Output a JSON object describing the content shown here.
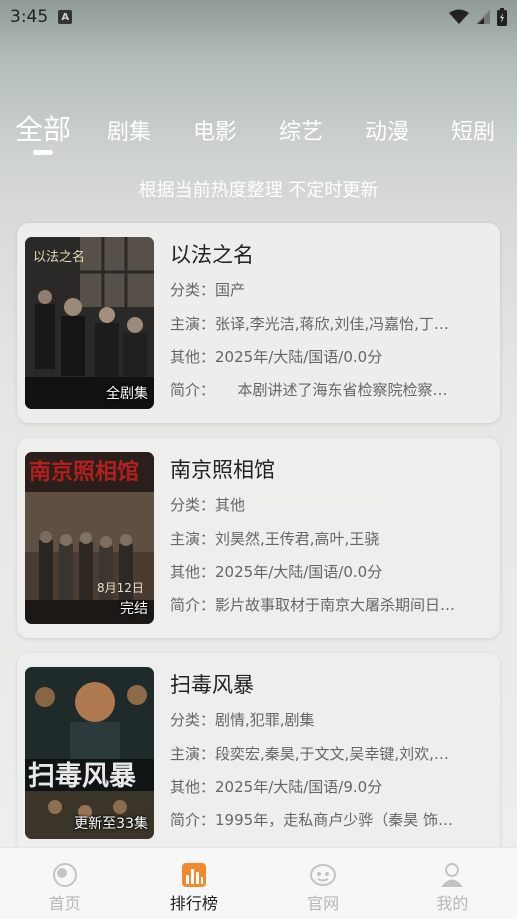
{
  "status": {
    "time": "3:45",
    "a_icon": "A"
  },
  "tabs": [
    {
      "label": "全部",
      "active": true
    },
    {
      "label": "剧集"
    },
    {
      "label": "电影"
    },
    {
      "label": "综艺"
    },
    {
      "label": "动漫"
    },
    {
      "label": "短剧"
    }
  ],
  "subtitle": "根据当前热度整理 不定时更新",
  "cards": [
    {
      "title": "以法之名",
      "badge": "全剧集",
      "category_label": "分类：",
      "category": "国产",
      "cast_label": "主演：",
      "cast": "张译,李光洁,蒋欣,刘佳,冯嘉怡,丁…",
      "other_label": "其他：",
      "other": "2025年/大陆/国语/0.0分",
      "intro_label": "简介：",
      "intro": "　　本剧讲述了海东省检察院检察…",
      "poster_colors": [
        "#2b2a28",
        "#59524a"
      ]
    },
    {
      "title": "南京照相馆",
      "badge": "完结",
      "category_label": "分类：",
      "category": "其他",
      "cast_label": "主演：",
      "cast": "刘昊然,王传君,高叶,王骁",
      "other_label": "其他：",
      "other": "2025年/大陆/国语/0.0分",
      "intro_label": "简介：",
      "intro": "影片故事取材于南京大屠杀期间日…",
      "poster_colors": [
        "#3a2a22",
        "#6b5a4b"
      ]
    },
    {
      "title": "扫毒风暴",
      "badge": "更新至33集",
      "category_label": "分类：",
      "category": "剧情,犯罪,剧集",
      "cast_label": "主演：",
      "cast": "段奕宏,秦昊,于文文,吴幸键,刘欢,…",
      "other_label": "其他：",
      "other": "2025年/大陆/国语/9.0分",
      "intro_label": "简介：",
      "intro": "1995年，走私商卢少骅（秦昊 饰…",
      "poster_colors": [
        "#1d2a2c",
        "#8a6a3c"
      ]
    }
  ],
  "nav": [
    {
      "label": "首页",
      "icon": "home-icon"
    },
    {
      "label": "排行榜",
      "icon": "chart-icon",
      "active": true
    },
    {
      "label": "官网",
      "icon": "web-icon"
    },
    {
      "label": "我的",
      "icon": "profile-icon"
    }
  ],
  "colors": {
    "accent": "#f08a2c",
    "nav_inactive": "#b7b7b7"
  }
}
